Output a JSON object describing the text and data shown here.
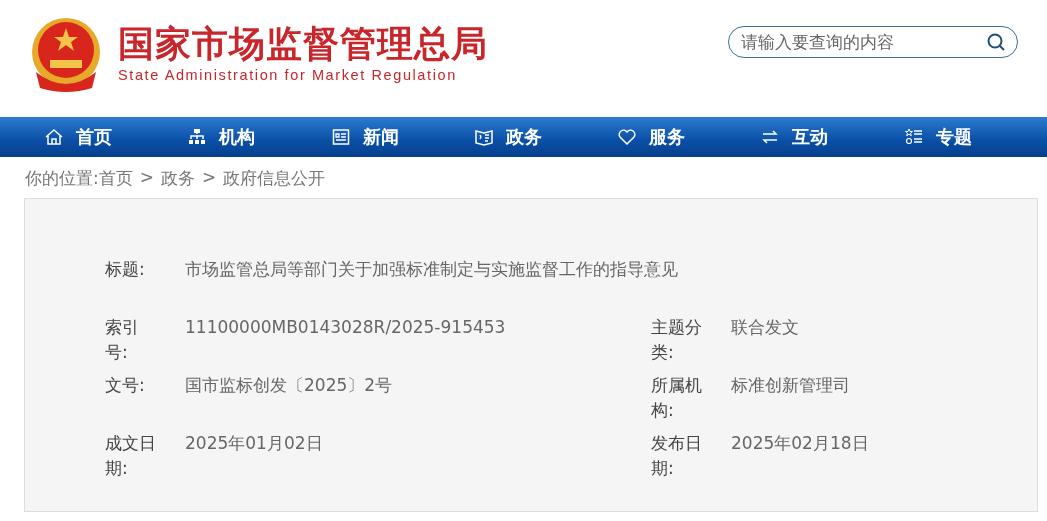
{
  "header": {
    "title": "国家市场监督管理总局",
    "subtitle": "State Administration for Market Regulation",
    "search": {
      "placeholder": "请输入要查询的内容"
    }
  },
  "nav": [
    {
      "label": "首页"
    },
    {
      "label": "机构"
    },
    {
      "label": "新闻"
    },
    {
      "label": "政务"
    },
    {
      "label": "服务"
    },
    {
      "label": "互动"
    },
    {
      "label": "专题"
    }
  ],
  "breadcrumb": [
    "你的位置:首页",
    ">",
    "政务",
    ">",
    "政府信息公开"
  ],
  "info": {
    "title": {
      "label": "标题:",
      "value": "市场监管总局等部门关于加强标准制定与实施监督工作的指导意见"
    },
    "rows": [
      {
        "label": "索引号:",
        "value": "11100000MB0143028R/2025-915453",
        "label_2": "主题分类:",
        "value_2": "联合发文"
      },
      {
        "label": "文号:",
        "value": "国市监标创发〔2025〕2号",
        "label_2": "所属机构:",
        "value_2": "标准创新管理司"
      },
      {
        "label": "成文日期:",
        "value": "2025年01月02日",
        "label_2": "发布日期:",
        "value_2": "2025年02月18日"
      }
    ]
  }
}
